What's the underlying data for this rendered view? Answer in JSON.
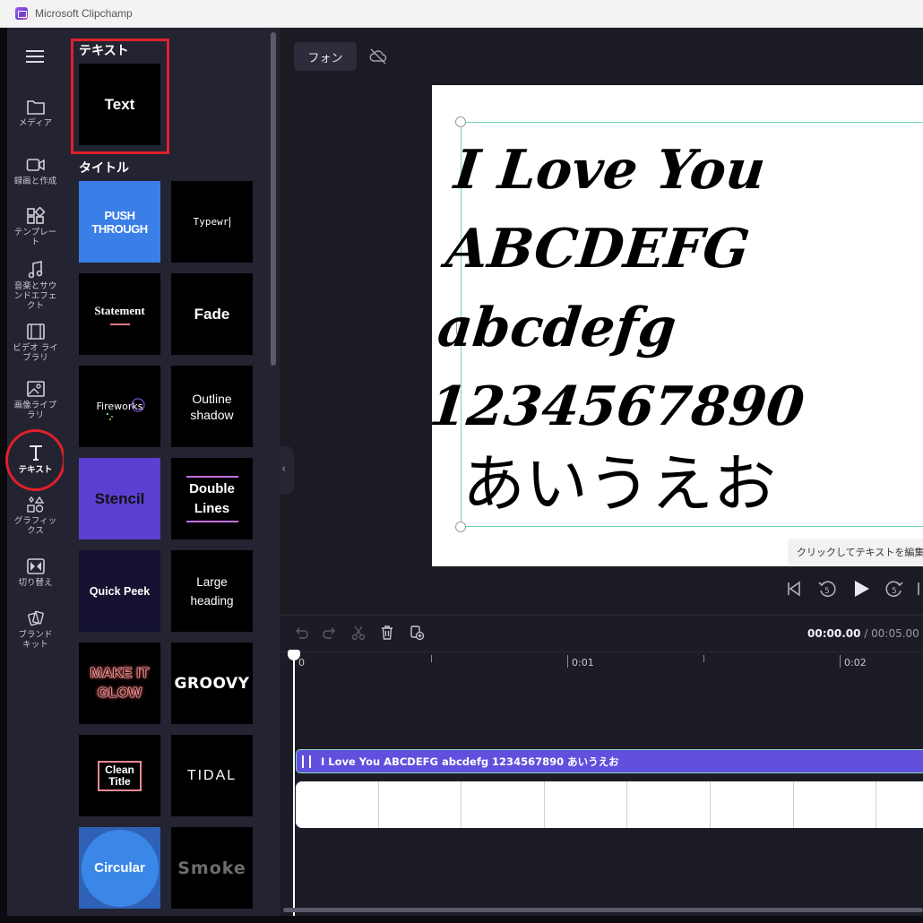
{
  "window": {
    "title": "Microsoft Clipchamp"
  },
  "rail": {
    "items": [
      {
        "label": "メディア",
        "icon": "folder-icon"
      },
      {
        "label": "録画と作成",
        "icon": "video-camera-icon"
      },
      {
        "label": "テンプレート",
        "icon": "template-grid-icon"
      },
      {
        "label": "音楽とサウンドエフェクト",
        "icon": "music-note-icon"
      },
      {
        "label": "ビデオ ライブラリ",
        "icon": "film-icon"
      },
      {
        "label": "画像ライブラリ",
        "icon": "image-icon"
      },
      {
        "label": "テキスト",
        "icon": "text-t-icon",
        "active": true
      },
      {
        "label": "グラフィックス",
        "icon": "shapes-icon"
      },
      {
        "label": "切り替え",
        "icon": "transition-icon"
      },
      {
        "label": "ブランド キット",
        "icon": "brand-kit-icon"
      }
    ]
  },
  "panel": {
    "text_heading": "テキスト",
    "text_card": "Text",
    "title_heading": "タイトル",
    "cards": [
      {
        "label": "PUSH THROUGH"
      },
      {
        "label": "Typewr"
      },
      {
        "label": "Statement"
      },
      {
        "label": "Fade"
      },
      {
        "label": "Fireworks"
      },
      {
        "label_line1": "Outline",
        "label_line2": "shadow"
      },
      {
        "label": "Stencil"
      },
      {
        "label_line1": "Double",
        "label_line2": "Lines"
      },
      {
        "label": "Quick Peek"
      },
      {
        "label_line1": "Large",
        "label_line2": "heading"
      },
      {
        "label_line1": "MAKE IT",
        "label_line2": "GLOW"
      },
      {
        "label": "GROOVY"
      },
      {
        "label_line1": "Clean",
        "label_line2": "Title"
      },
      {
        "label": "TIDAL"
      },
      {
        "label": "Circular"
      },
      {
        "label": "Smoke"
      }
    ]
  },
  "toolbar": {
    "font_label": "フォン"
  },
  "canvas": {
    "line1": "I Love You",
    "line2": "ABCDEFG",
    "line3": "abcdefg",
    "line4": "1234567890",
    "line5": "あいうえお",
    "tooltip": "クリックしてテキストを編集する"
  },
  "timeline": {
    "current_time": "00:00.00",
    "separator": " / ",
    "total_time": "00:05.00",
    "ticks": [
      "0",
      "0:01",
      "0:02"
    ],
    "text_clip_label": "I Love You ABCDEFG abcdefg 1234567890 あいうえお"
  },
  "colors": {
    "accent": "#6050dd",
    "annotation_red": "#e0202a",
    "selection": "#6ed6b6"
  }
}
